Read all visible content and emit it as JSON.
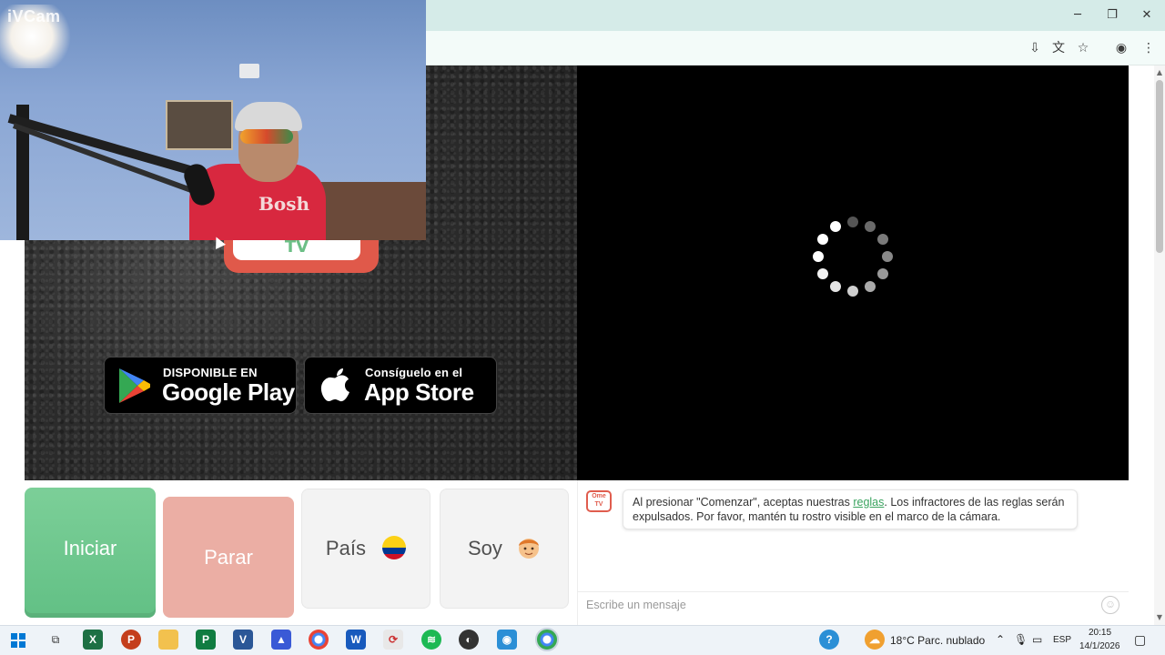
{
  "overlay": {
    "webcam_label": "iVCam",
    "shirt_text": "Bosh"
  },
  "browser": {
    "window_controls": {
      "minimize": "─",
      "maximize": "❐",
      "close": "✕"
    },
    "toolbar_icons": [
      "install-icon",
      "translate-icon",
      "star-icon",
      "profile-icon",
      "menu-icon"
    ]
  },
  "logo": {
    "text": "TV"
  },
  "stores": {
    "google": {
      "small": "DISPONIBLE EN",
      "big": "Google Play"
    },
    "apple": {
      "small": "Consíguelo en el",
      "big": "App Store"
    }
  },
  "controls": {
    "start": "Iniciar",
    "stop": "Parar",
    "country": "País",
    "country_flag": "colombia-flag",
    "iam": "Soy",
    "iam_icon": "boy-emoji"
  },
  "chat": {
    "avatar_text": "Ome TV",
    "message_pre": "Al presionar \"Comenzar\", aceptas nuestras ",
    "message_link": "reglas",
    "message_post": ". Los infractores de las reglas serán expulsados. Por favor, mantén tu rostro visible en el marco de la cámara.",
    "input_placeholder": "Escribe un mensaje"
  },
  "taskbar": {
    "weather": "18°C  Parc. nublado",
    "language": "ESP",
    "time": "20:15",
    "date": "14/1/2026"
  },
  "colors": {
    "start_green": "#6cc48b",
    "stop_salmon": "#ebaea4",
    "ome_red": "#e05d4e",
    "link_green": "#3aa35f"
  }
}
